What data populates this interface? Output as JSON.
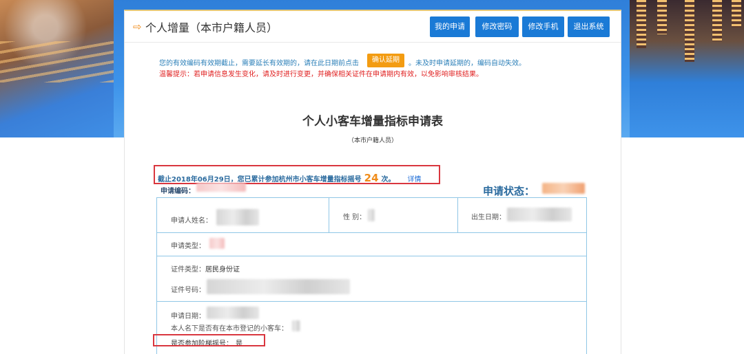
{
  "header": {
    "title": "个人增量（本市户籍人员）",
    "buttons": {
      "my_application": "我的申请",
      "change_password": "修改密码",
      "change_phone": "修改手机",
      "logout": "退出系统"
    }
  },
  "notices": {
    "validity_before": "您的有效编码有效期截止，需要延长有效期的，请在此日期前点击",
    "confirm_extension": "确认延期",
    "validity_after": "。未及时申请延期的，编码自动失效。",
    "warm_tip": "温馨提示：若申请信息发生变化，请及时进行变更，并确保相关证件在申请期内有效，以免影响审核结果。"
  },
  "form": {
    "title": "个人小客车增量指标申请表",
    "subtitle": "（本市户籍人员）",
    "count_prefix": "截止2018年06月29日，您已累计参加杭州市小客车增量指标摇号",
    "count_value": "24",
    "count_suffix": "次。",
    "detail_link": "详情",
    "app_code_label": "申请编码：",
    "app_status_label": "申请状态："
  },
  "table": {
    "applicant_name_label": "申请人姓名：",
    "gender_label": "性 别：",
    "birth_label": "出生日期：",
    "app_type_label": "申请类型：",
    "id_type_label": "证件类型：",
    "id_type_value": "居民身份证",
    "id_number_label": "证件号码：",
    "apply_date_label": "申请日期：",
    "registered_car_label": "本人名下是否有在本市登记的小客车：",
    "ladder_label": "是否参加阶梯摇号：",
    "ladder_value": "是"
  },
  "colors": {
    "primary_button": "#1a7ad6",
    "confirm_button": "#f39c12",
    "highlight_box": "#d9363e",
    "count_number": "#f08c1a",
    "table_border": "#8fc6e6",
    "warning_text": "#e02020"
  },
  "icons": {
    "title_arrow": "arrow-right-icon"
  }
}
